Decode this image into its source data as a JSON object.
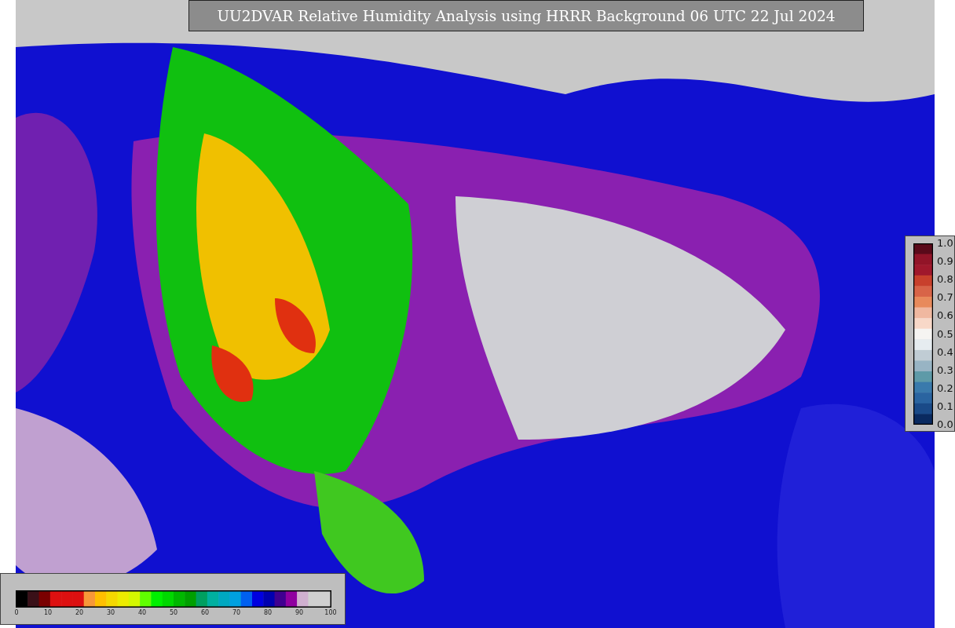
{
  "title": "UU2DVAR Relative Humidity Analysis using HRRR Background 06 UTC 22 Jul 2024",
  "increment_colorbar": {
    "ticks": [
      "1.0",
      "0.9",
      "0.8",
      "0.7",
      "0.6",
      "0.5",
      "0.4",
      "0.3",
      "0.2",
      "0.1",
      "0.0"
    ]
  },
  "humidity_colorbar": {
    "ticks": [
      "0",
      "10",
      "20",
      "30",
      "40",
      "50",
      "60",
      "70",
      "80",
      "90",
      "100"
    ]
  }
}
